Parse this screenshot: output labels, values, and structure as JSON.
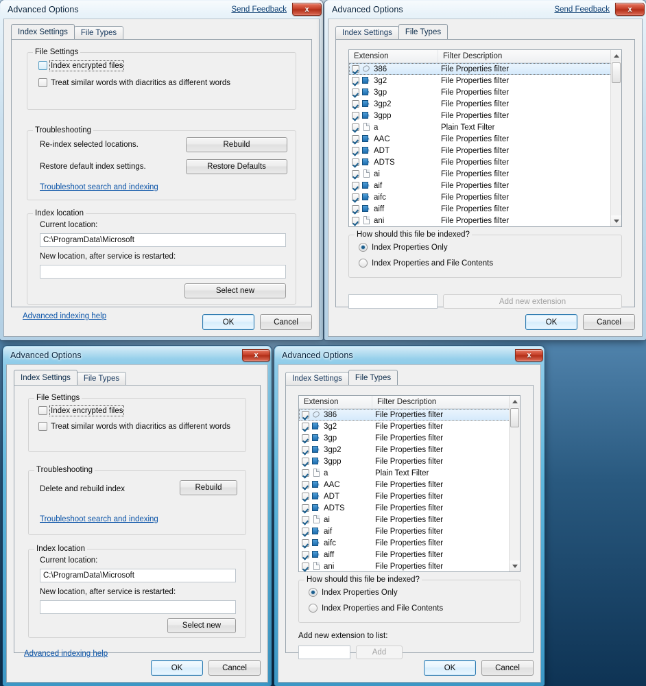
{
  "common": {
    "window_title": "Advanced Options",
    "send_feedback": "Send Feedback",
    "close_glyph": "x",
    "tabs": {
      "index_settings": "Index Settings",
      "file_types": "File Types"
    },
    "ok": "OK",
    "cancel": "Cancel",
    "accent_blue": "#2c7ab0",
    "link_color": "#0b54a8",
    "close_red": "#c33c25"
  },
  "index_settings": {
    "file_settings_legend": "File Settings",
    "index_encrypted_label": "Index encrypted files",
    "index_encrypted_checked": false,
    "diacritics_label": "Treat similar words with diacritics as different words",
    "diacritics_checked": false,
    "troubleshooting_legend": "Troubleshooting",
    "reindex_label": "Re-index selected locations.",
    "rebuild_button": "Rebuild",
    "restore_label": "Restore default index settings.",
    "restore_button": "Restore Defaults",
    "troubleshoot_link": "Troubleshoot search and indexing",
    "index_location_legend": "Index location",
    "current_location_label": "Current location:",
    "current_location_value": "C:\\ProgramData\\Microsoft",
    "new_location_label": "New location, after service is restarted:",
    "new_location_value": "",
    "select_new_button": "Select new",
    "advanced_help_link": "Advanced indexing help"
  },
  "index_settings_old": {
    "file_settings_legend": "File Settings",
    "index_encrypted_label": "Index encrypted files",
    "diacritics_label": "Treat similar words with diacritics as different words",
    "troubleshooting_legend": "Troubleshooting",
    "delete_rebuild_label": "Delete and rebuild index",
    "rebuild_button": "Rebuild",
    "troubleshoot_link": "Troubleshoot search and indexing",
    "index_location_legend": "Index location",
    "current_location_label": "Current location:",
    "current_location_value": "C:\\ProgramData\\Microsoft",
    "new_location_label": "New location, after service is restarted:",
    "new_location_value": "",
    "select_new_button": "Select new",
    "advanced_help_link": "Advanced indexing help"
  },
  "file_types": {
    "col_extension": "Extension",
    "col_filter": "Filter Description",
    "rows": [
      {
        "ext": "386",
        "filter": "File Properties filter",
        "checked": true,
        "icon": "clip-file-icon",
        "selected": true
      },
      {
        "ext": "3g2",
        "filter": "File Properties filter",
        "checked": true,
        "icon": "media-file-icon",
        "selected": false
      },
      {
        "ext": "3gp",
        "filter": "File Properties filter",
        "checked": true,
        "icon": "media-file-icon",
        "selected": false
      },
      {
        "ext": "3gp2",
        "filter": "File Properties filter",
        "checked": true,
        "icon": "media-file-icon",
        "selected": false
      },
      {
        "ext": "3gpp",
        "filter": "File Properties filter",
        "checked": true,
        "icon": "media-file-icon",
        "selected": false
      },
      {
        "ext": "a",
        "filter": "Plain Text Filter",
        "checked": true,
        "icon": "plain-file-icon",
        "selected": false
      },
      {
        "ext": "AAC",
        "filter": "File Properties filter",
        "checked": true,
        "icon": "media-file-icon",
        "selected": false
      },
      {
        "ext": "ADT",
        "filter": "File Properties filter",
        "checked": true,
        "icon": "media-file-icon",
        "selected": false
      },
      {
        "ext": "ADTS",
        "filter": "File Properties filter",
        "checked": true,
        "icon": "media-file-icon",
        "selected": false
      },
      {
        "ext": "ai",
        "filter": "File Properties filter",
        "checked": true,
        "icon": "plain-file-icon",
        "selected": false
      },
      {
        "ext": "aif",
        "filter": "File Properties filter",
        "checked": true,
        "icon": "media-file-icon",
        "selected": false
      },
      {
        "ext": "aifc",
        "filter": "File Properties filter",
        "checked": true,
        "icon": "media-file-icon",
        "selected": false
      },
      {
        "ext": "aiff",
        "filter": "File Properties filter",
        "checked": true,
        "icon": "media-file-icon",
        "selected": false
      },
      {
        "ext": "ani",
        "filter": "File Properties filter",
        "checked": true,
        "icon": "plain-file-icon",
        "selected": false
      }
    ],
    "how_indexed_legend": "How should this file be indexed?",
    "radio_properties_only": "Index Properties Only",
    "radio_properties_and_contents": "Index Properties and File Contents",
    "selected_radio": "Index Properties Only",
    "new_ext_value": "",
    "add_new_extension_button": "Add new extension",
    "add_new_extension_label": "Add new extension to list:",
    "add_button": "Add"
  }
}
